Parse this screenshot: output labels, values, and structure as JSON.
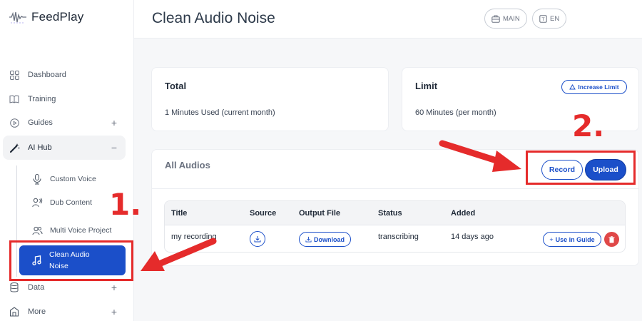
{
  "app": {
    "name": "FeedPlay"
  },
  "sidebar": {
    "items": [
      {
        "label": "Dashboard",
        "icon": "grid-icon"
      },
      {
        "label": "Training",
        "icon": "book-icon"
      },
      {
        "label": "Guides",
        "icon": "play-circle-icon",
        "toggle": "+"
      },
      {
        "label": "AI Hub",
        "icon": "magic-wand-icon",
        "toggle": "−"
      },
      {
        "label": "Data",
        "icon": "database-icon",
        "toggle": "+"
      },
      {
        "label": "More",
        "icon": "home-icon",
        "toggle": "+"
      }
    ],
    "ai_hub_children": [
      {
        "label": "Custom Voice",
        "icon": "microphone-icon"
      },
      {
        "label": "Dub Content",
        "icon": "user-voice-icon"
      },
      {
        "label": "Multi Voice Project",
        "icon": "users-icon"
      },
      {
        "label": "Clean Audio Noise",
        "icon": "music-note-icon",
        "active": true
      }
    ]
  },
  "header": {
    "title": "Clean Audio Noise",
    "main_chip": "MAIN",
    "lang_chip": "EN"
  },
  "total_card": {
    "title": "Total",
    "text": "1 Minutes Used (current month)"
  },
  "limit_card": {
    "title": "Limit",
    "text": "60 Minutes (per month)",
    "increase_label": "Increase Limit"
  },
  "audios": {
    "title": "All Audios",
    "record_label": "Record",
    "upload_label": "Upload",
    "columns": [
      "Title",
      "Source",
      "Output File",
      "Status",
      "Added"
    ],
    "rows": [
      {
        "title": "my recording",
        "download_label": "Download",
        "status": "transcribing",
        "added": "14 days ago",
        "use_in_guide_label": "Use in Guide"
      }
    ]
  },
  "annotations": {
    "step1": "1.",
    "step2": "2."
  },
  "colors": {
    "accent": "#1b4fc9",
    "annotation_red": "#e52b2b",
    "delete_red": "#e04848"
  }
}
